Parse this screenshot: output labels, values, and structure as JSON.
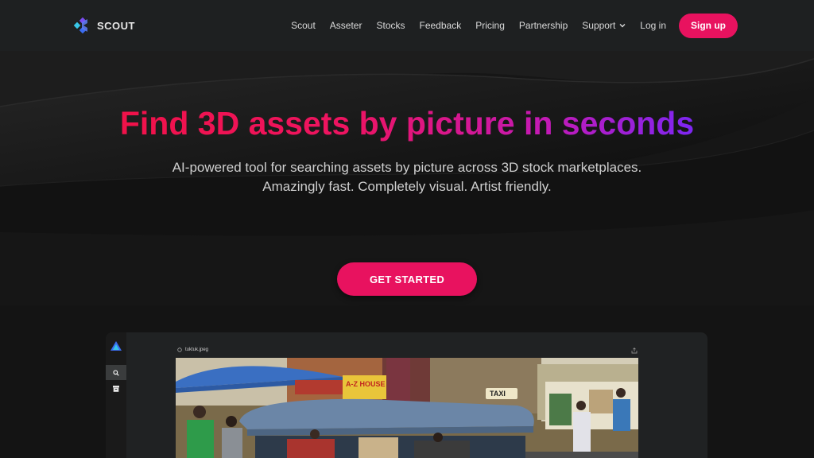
{
  "nav": {
    "brand": "SCOUT",
    "items": [
      "Scout",
      "Asseter",
      "Stocks",
      "Feedback",
      "Pricing",
      "Partnership",
      "Support"
    ],
    "login": "Log in",
    "signup": "Sign up"
  },
  "hero": {
    "headline": "Find 3D assets by picture in seconds",
    "subtitle_line1": "AI-powered tool for searching assets by picture across 3D stock marketplaces.",
    "subtitle_line2": "Amazingly fast. Completely visual. Artist friendly.",
    "cta": "GET STARTED"
  },
  "preview": {
    "file_name": "tuktuk.jpeg",
    "sign_text": "A-Z HOUSE",
    "taxi_text": "TAXI"
  },
  "colors": {
    "accent": "#e8125f",
    "gradient_start": "#f01249",
    "gradient_end": "#7d26f2",
    "nav_bg": "#1e2021",
    "page_bg": "#141414"
  }
}
